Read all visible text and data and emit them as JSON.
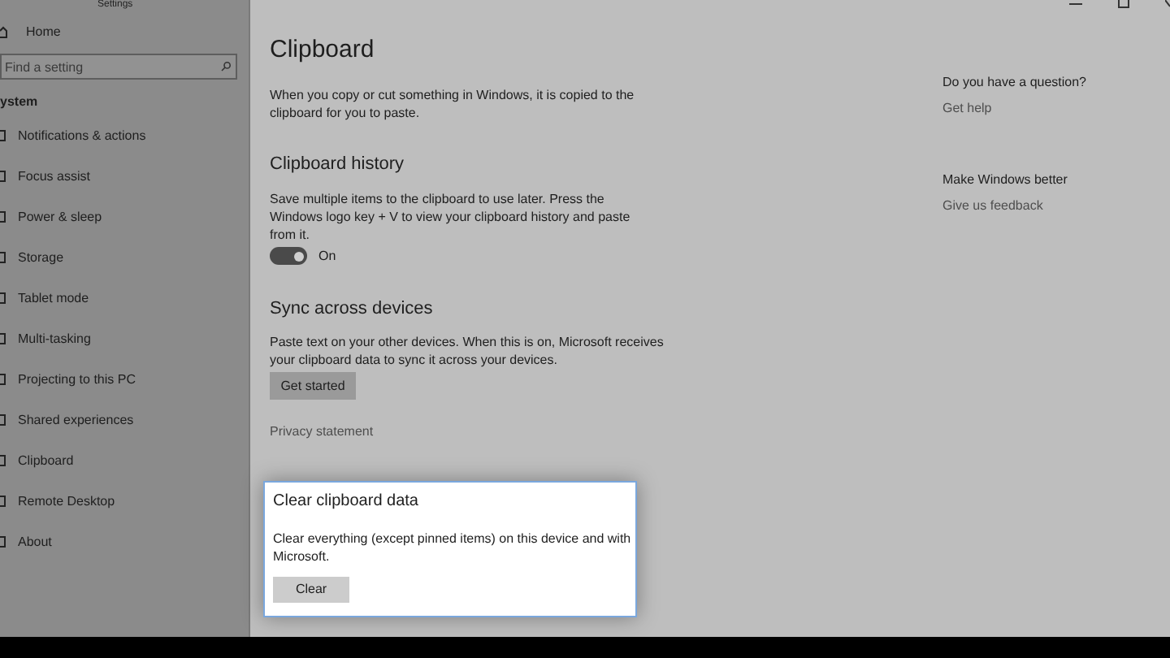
{
  "window": {
    "title": "Settings"
  },
  "sidebar": {
    "home": "Home",
    "search": {
      "placeholder": "Find a setting"
    },
    "section": "ystem",
    "items": [
      {
        "label": "Notifications & actions"
      },
      {
        "label": "Focus assist"
      },
      {
        "label": "Power & sleep"
      },
      {
        "label": "Storage"
      },
      {
        "label": "Tablet mode"
      },
      {
        "label": "Multi-tasking"
      },
      {
        "label": "Projecting to this PC"
      },
      {
        "label": "Shared experiences"
      },
      {
        "label": "Clipboard"
      },
      {
        "label": "Remote Desktop"
      },
      {
        "label": "About"
      }
    ]
  },
  "main": {
    "title": "Clipboard",
    "intro": "When you copy or cut something in Windows, it is copied to the clipboard for you to paste.",
    "history": {
      "heading": "Clipboard history",
      "description": "Save multiple items to the clipboard to use later. Press the Windows logo key + V to view your clipboard history and paste from it.",
      "toggle": {
        "on": true,
        "label": "On"
      }
    },
    "sync": {
      "heading": "Sync across devices",
      "description": "Paste text on your other devices. When this is on, Microsoft receives your clipboard data to sync it across your devices.",
      "button": "Get started"
    },
    "privacy_link": "Privacy statement"
  },
  "dialog": {
    "title": "Clear clipboard data",
    "description": "Clear everything (except pinned items) on this device and with Microsoft.",
    "button": "Clear"
  },
  "aside": [
    {
      "heading": "Do you have a question?",
      "link": "Get help"
    },
    {
      "heading": "Make Windows better",
      "link": "Give us feedback"
    }
  ]
}
